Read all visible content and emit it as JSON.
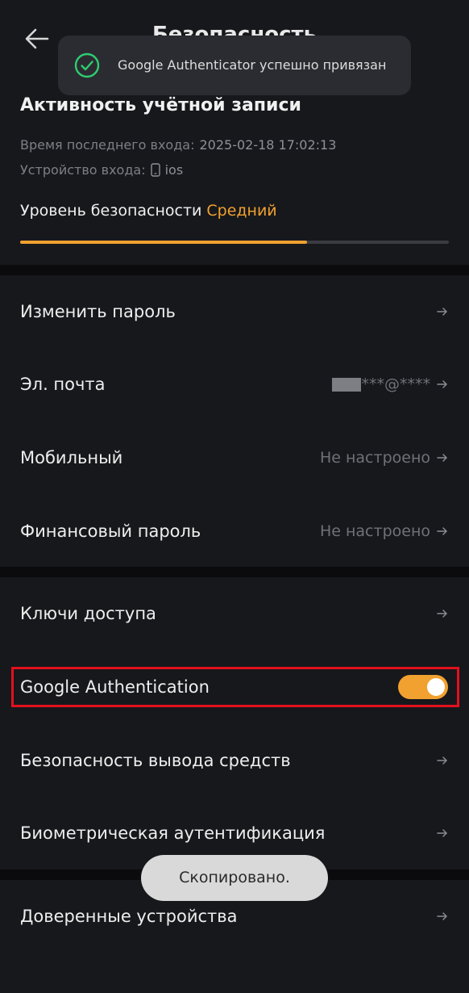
{
  "header": {
    "title": "Безопасность"
  },
  "toast": {
    "message": "Google Authenticator успешно привязан",
    "copied": "Скопировано."
  },
  "account": {
    "title": "Активность учётной записи",
    "last_login_label": "Время последнего входа:",
    "last_login_value": "2025-02-18 17:02:13",
    "device_label": "Устройство входа:",
    "device_value": "ios",
    "security_level_label": "Уровень безопасности",
    "security_level_value": "Средний",
    "security_level_progress": 0.67
  },
  "groups": {
    "main": [
      {
        "label": "Изменить пароль",
        "value": ""
      },
      {
        "label": "Эл. почта",
        "value": "***@****"
      },
      {
        "label": "Мобильный",
        "value": "Не настроено"
      },
      {
        "label": "Финансовый пароль",
        "value": "Не настроено"
      }
    ],
    "second": [
      {
        "label": "Ключи доступа"
      },
      {
        "label": "Google Authentication",
        "toggle_on": true
      },
      {
        "label": "Безопасность вывода средств"
      },
      {
        "label": "Биометрическая аутентификация"
      }
    ],
    "third": [
      {
        "label": "Доверенные устройства"
      }
    ]
  },
  "colors": {
    "accent": "#f0a12f",
    "background": "#17181c",
    "success": "#2ecc71",
    "highlight": "#e3101d"
  },
  "icons": {
    "back": "arrow-left-icon",
    "check": "check-circle-icon",
    "phone": "phone-icon",
    "arrow": "arrow-right-icon"
  }
}
